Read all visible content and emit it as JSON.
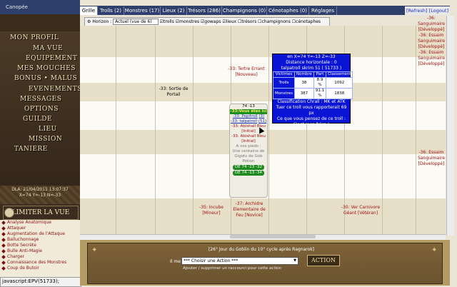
{
  "left": {
    "banner": "Canopée",
    "menu": [
      "MON PROFIL",
      "MA VUE",
      "EQUIPEMENT",
      "MES MOUCHES",
      "BONUS • MALUS",
      "EVENEMENTS",
      "MESSAGES",
      "OPTIONS",
      "GUILDE",
      "LIEU",
      "MISSION",
      "TANIERE"
    ],
    "datetime": "DLA: 21/04/2011 13:07:37",
    "position": "X=74 Y=-13 N=-33",
    "limit_button": "LIMITER LA VUE",
    "skills": [
      "Analyse Anatomique",
      "Attaquer",
      "Augmentation de l'Attaque",
      "Balluchonnage",
      "Botte Secrète",
      "Bulle Anti-Magie",
      "Charger",
      "Connaissance des Monstres",
      "Coup de Butoir"
    ],
    "status": "javascript:EPV(51733);"
  },
  "tabs": [
    {
      "label": "Grille",
      "active": true
    },
    {
      "label": "Trolls (2)"
    },
    {
      "label": "Monstres (17)"
    },
    {
      "label": "Lieux (2)"
    },
    {
      "label": "Trésors (286)"
    },
    {
      "label": "Champignons (0)"
    },
    {
      "label": "Cénotaphes (0)"
    },
    {
      "label": "Réglages"
    }
  ],
  "refresh": "[Refresh]",
  "logout": "[Logout]",
  "controls": {
    "horizon_label": "Horizon :",
    "horizon_value": "Actuel (vue de 6)",
    "filters": [
      "trolls",
      "monstres",
      "gowaps",
      "lieux",
      "trésors",
      "champignons",
      "cénotaphes"
    ]
  },
  "grid_cells": {
    "top_right": [
      "-36: Sanguimaire",
      "[Développé]",
      "-36: Essaim",
      "Sanguimaire",
      "[Développé]",
      "-36: Essaim",
      "Sanguimaire",
      "[Développé]"
    ],
    "tertre": "-33: Tertre Errant",
    "tertre_tag": "[Nouveau]",
    "portail": "-33: Sortie de",
    "portail_2": "Portail",
    "right_mid": [
      "-36: Essaim",
      "Sanguimaire",
      "[Développé]"
    ],
    "incube": "-35: Incube",
    "incube_tag": "[Mineur]",
    "archi": "-37: Archidre",
    "archi_2": "Elementaire de",
    "archi_3": "Feu [Novice]",
    "ver": "-30: Ver Carnivore",
    "ver_2": "Géant [Vétéran]"
  },
  "popup": {
    "coords": "en X=74 Y=-13 Z=-33",
    "distance": "Distance horizontale : 0",
    "troll": "talpatroll skrim 51 ( 51733 )",
    "headers": [
      "Victimes",
      "Nombre",
      "Part",
      "Classement"
    ],
    "rows": [
      [
        "Trolls",
        "38",
        "8.9 %",
        "1092"
      ],
      [
        "Monstres",
        "387",
        "91.1 %",
        "1838"
      ]
    ],
    "classification": "Classification Chrall : MK et ATK",
    "gain": "Tuer ce troll vous rapporterait 69 px",
    "question": "Ce que vous pensez de ce troll :",
    "answer": "C'est mon frère !"
  },
  "bubble": {
    "header": "74 -13",
    "here": "-33:Vous êtes ici",
    "pepitroll": "-33: Pepitroll",
    "pepitroll_num": "(3)",
    "talpa": "-33: talpatroll",
    "talpa_num": "(51)",
    "abishall1": "-33: Abishall Bleu",
    "abishall1_tag": "[Initial]",
    "abishall2": "-33: Abishall Bleu",
    "abishall2_tag": "[Initial]",
    "feet": "A vos pieds :",
    "centaine": "Une centaine de",
    "gigots": "Gigots de Gob",
    "potion": "Potion",
    "de1": "DE 74 -13 -32",
    "de2": "DE 74 -13 -34"
  },
  "bottom": {
    "cycle": "[26° Jour du Goblin du 10° cycle après Ragnarok]",
    "pa_label": "Il me reste 6 PA :",
    "select": "*** Choisir une Action ***",
    "action": "ACTION",
    "shortcut": "Ajouter / supprimer un raccourci pour cette action"
  }
}
